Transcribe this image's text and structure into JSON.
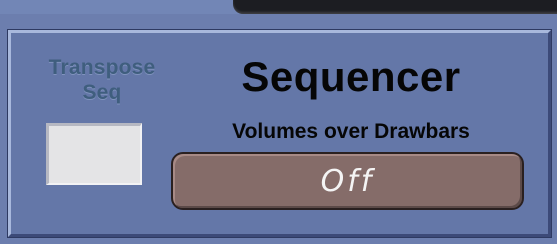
{
  "transpose": {
    "label": "Transpose\nSeq",
    "value": ""
  },
  "sequencer": {
    "title": "Sequencer",
    "subtitle": "Volumes over Drawbars",
    "toggle_label": "Off"
  },
  "colors": {
    "background": "#6c7eae",
    "panel": "#6477a8",
    "transpose_label": "#3f5e7e",
    "toggle_button": "#856c69",
    "toggle_text": "#f4f4f4"
  }
}
